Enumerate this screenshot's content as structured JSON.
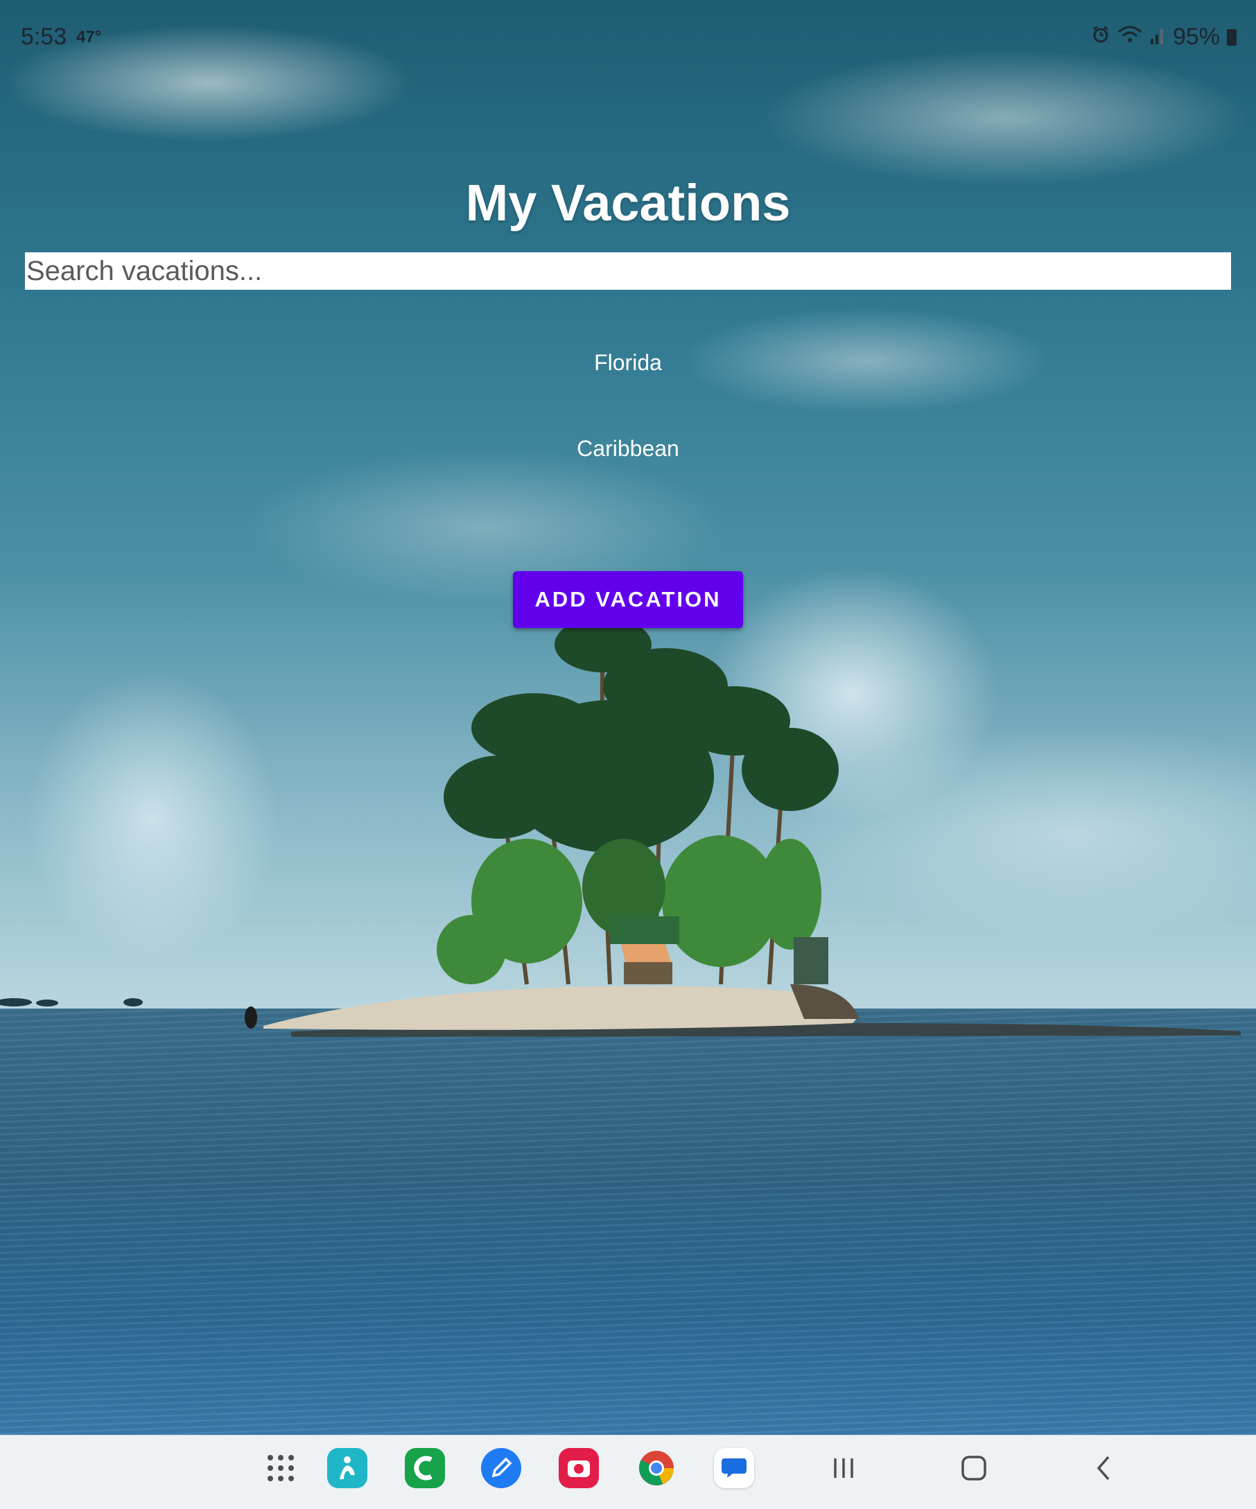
{
  "status_bar": {
    "time": "5:53",
    "temperature": "47°",
    "battery": "95%",
    "icons": [
      "alarm-icon",
      "wifi-icon",
      "signal-icon",
      "battery-icon"
    ]
  },
  "app": {
    "title": "My Vacations",
    "search": {
      "placeholder": "Search vacations...",
      "value": ""
    },
    "vacations": [
      {
        "name": "Florida"
      },
      {
        "name": "Caribbean"
      }
    ],
    "add_button_label": "ADD VACATION",
    "accent_color": "#6200ee"
  },
  "taskbar": {
    "apps": [
      {
        "name": "app-drawer-icon"
      },
      {
        "name": "bixby-icon",
        "color": "#1fb6c8"
      },
      {
        "name": "phone-app-icon",
        "color": "#16a34a"
      },
      {
        "name": "notes-pen-icon",
        "color": "#1e7bf2"
      },
      {
        "name": "camera-app-icon",
        "color": "#e11d48"
      },
      {
        "name": "chrome-icon"
      },
      {
        "name": "messages-icon",
        "color": "#1a6de0"
      }
    ],
    "nav": [
      "recents-icon",
      "home-icon",
      "back-icon"
    ]
  }
}
